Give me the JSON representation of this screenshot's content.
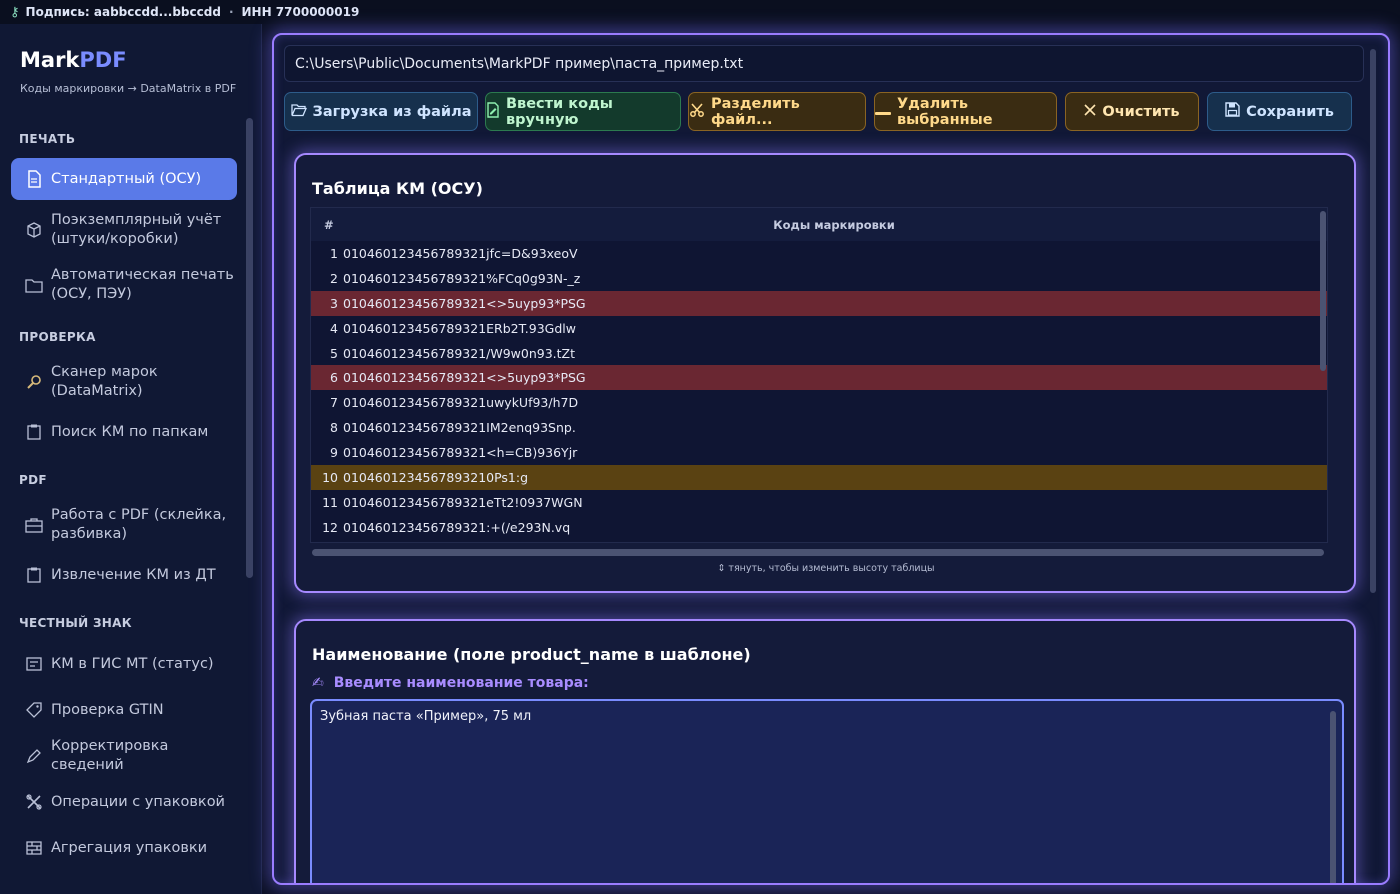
{
  "topbar": {
    "signature": "Подпись: aabbccdd...bbccdd",
    "separator": "·",
    "inn": "ИНН 7700000019"
  },
  "brand": {
    "name_part1": "Mark",
    "name_part2": "PDF",
    "subtitle": "Коды маркировки → DataMatrix в PDF"
  },
  "sidebar": {
    "sections": [
      {
        "title": "ПЕЧАТЬ"
      },
      {
        "title": "ПРОВЕРКА"
      },
      {
        "title": "PDF"
      },
      {
        "title": "ЧЕСТНЫЙ ЗНАК"
      }
    ],
    "items": [
      {
        "label": "Стандартный (ОСУ)",
        "icon": "document-icon"
      },
      {
        "label": "Поэкземплярный учёт (штуки/коробки)",
        "icon": "box-icon"
      },
      {
        "label": "Автоматическая печать (ОСУ, ПЭУ)",
        "icon": "folder-icon"
      },
      {
        "label": "Сканер марок (DataMatrix)",
        "icon": "magnifier-icon"
      },
      {
        "label": "Поиск КМ по папкам",
        "icon": "clipboard-icon"
      },
      {
        "label": "Работа с PDF (склейка, разбивка)",
        "icon": "briefcase-icon"
      },
      {
        "label": "Извлечение КМ из ДТ",
        "icon": "clipboard-icon"
      },
      {
        "label": "КМ в ГИС МТ (статус)",
        "icon": "card-icon"
      },
      {
        "label": "Проверка GTIN",
        "icon": "tag-icon"
      },
      {
        "label": "Корректировка сведений",
        "icon": "pencil-icon"
      },
      {
        "label": "Операции с упаковкой",
        "icon": "tools-icon"
      },
      {
        "label": "Агрегация упаковки",
        "icon": "bricks-icon"
      }
    ]
  },
  "main": {
    "file_path": "C:\\Users\\Public\\Documents\\MarkPDF пример\\паста_пример.txt",
    "buttons": {
      "load": "Загрузка из файла",
      "manual": "Ввести коды вручную",
      "split": "Разделить файл...",
      "delete": "Удалить выбранные",
      "clear": "Очистить",
      "save": "Сохранить"
    },
    "table_panel": {
      "title": "Таблица КМ (ОСУ)",
      "col_num": "#",
      "col_code": "Коды маркировки",
      "rows": [
        {
          "n": "1",
          "code": "010460123456789321jfc=D&93xeoV"
        },
        {
          "n": "2",
          "code": "010460123456789321%FCq0g93N-_z"
        },
        {
          "n": "3",
          "code": "010460123456789321<>5uyp93*PSG"
        },
        {
          "n": "4",
          "code": "010460123456789321ERb2T.93Gdlw"
        },
        {
          "n": "5",
          "code": "010460123456789321/W9w0n93.tZt"
        },
        {
          "n": "6",
          "code": "010460123456789321<>5uyp93*PSG"
        },
        {
          "n": "7",
          "code": "010460123456789321uwykUf93/h7D"
        },
        {
          "n": "8",
          "code": "010460123456789321IM2enq93Snp."
        },
        {
          "n": "9",
          "code": "010460123456789321<h=CB)936Yjr"
        },
        {
          "n": "10",
          "code": "0104601234567893210Ps1:g"
        },
        {
          "n": "11",
          "code": "010460123456789321eTt2!0937WGN"
        },
        {
          "n": "12",
          "code": "010460123456789321:+(/e293N.vq"
        }
      ],
      "hint": "⇕ тянуть, чтобы изменить высоту таблицы"
    },
    "name_panel": {
      "title": "Наименование (поле product_name в шаблоне)",
      "label": "Введите наименование товара:",
      "value": "Зубная паста «Пример», 75 мл"
    }
  },
  "colors": {
    "accent": "#5a7ae8",
    "glow": "#9a7cff",
    "duplicate_row": "#6a2732",
    "warning_row": "#5a4212"
  }
}
